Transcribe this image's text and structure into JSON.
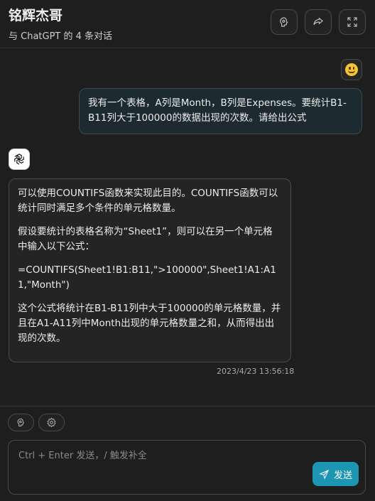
{
  "header": {
    "title": "铭辉杰哥",
    "subtitle": "与 ChatGPT 的 4 条对话",
    "buttons": [
      {
        "icon": "brain-icon"
      },
      {
        "icon": "share-icon"
      },
      {
        "icon": "fullscreen-icon"
      }
    ]
  },
  "messages": {
    "user": {
      "avatar_icon": "smiley-emoji-icon",
      "text": "我有一个表格，A列是Month，B列是Expenses。要统计B1-B11列大于100000的数据出现的次数。请给出公式"
    },
    "bot": {
      "avatar_icon": "openai-logo-icon",
      "paragraphs": [
        "可以使用COUNTIFS函数来实现此目的。COUNTIFS函数可以统计同时满足多个条件的单元格数量。",
        "假设要统计的表格名称为“Sheet1”，则可以在另一个单元格中输入以下公式：",
        "=COUNTIFS(Sheet1!B1:B11,\">100000\",Sheet1!A1:A11,\"Month\")",
        "这个公式将统计在B1-B11列中大于100000的单元格数量，并且在A1-A11列中Month出现的单元格数量之和，从而得出出现的次数。"
      ],
      "timestamp": "2023/4/23 13:56:18"
    }
  },
  "toolbar": {
    "tools": [
      {
        "icon": "brain-icon"
      },
      {
        "icon": "settings-icon"
      }
    ]
  },
  "composer": {
    "placeholder": "Ctrl + Enter 发送，/ 触发补全",
    "send_label": "发送",
    "send_color": "#1d96b3"
  }
}
